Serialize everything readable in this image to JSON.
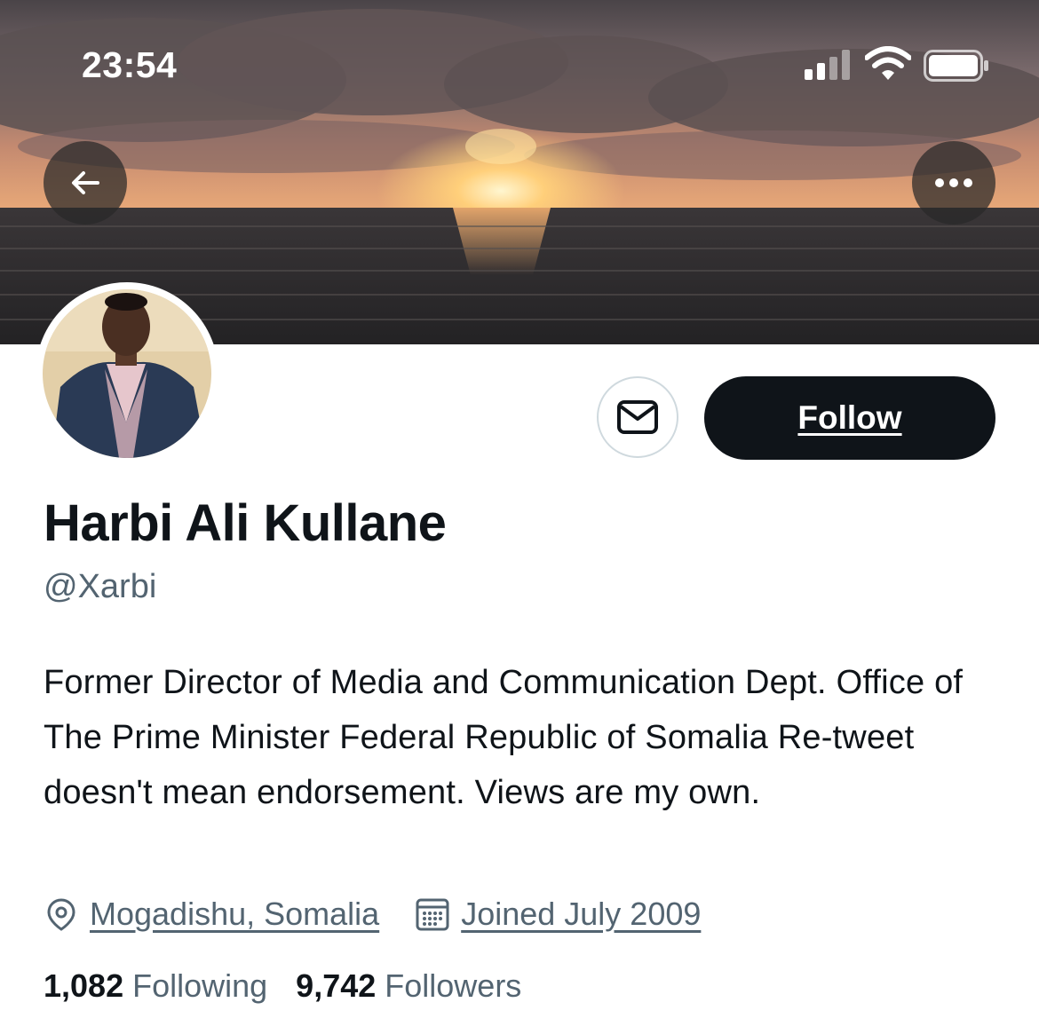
{
  "status_bar": {
    "time": "23:54"
  },
  "profile": {
    "display_name": "Harbi Ali Kullane",
    "handle": "@Xarbi",
    "bio": "Former Director of Media and Communication Dept. Office of The Prime Minister Federal Republic of Somalia Re-tweet doesn't mean endorsement. Views are my own.",
    "location": "Mogadishu, Somalia",
    "joined": "Joined July 2009"
  },
  "actions": {
    "follow_label": "Follow"
  },
  "stats": {
    "following_count": "1,082",
    "following_label": "Following",
    "followers_count": "9,742",
    "followers_label": "Followers"
  },
  "icons": {
    "back": "arrow-left-icon",
    "more": "more-horizontal-icon",
    "message": "envelope-icon",
    "location": "location-pin-icon",
    "calendar": "calendar-icon"
  },
  "colors": {
    "text_primary": "#0f1419",
    "text_secondary": "#536471",
    "follow_bg": "#0f1419",
    "border": "#cfd9de"
  }
}
